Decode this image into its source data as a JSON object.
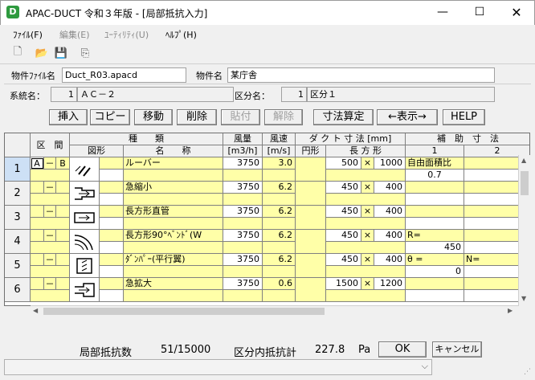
{
  "window": {
    "title": "APAC-DUCT 令和３年版 - [局部抵抗入力]",
    "icon": "D"
  },
  "menu": [
    {
      "label": "ﾌｧｲﾙ(F)",
      "enabled": true
    },
    {
      "label": "編集(E)",
      "enabled": false
    },
    {
      "label": "ﾕｰﾃｨﾘﾃｨ(U)",
      "enabled": false
    },
    {
      "label": "ﾍﾙﾌﾟ(H)",
      "enabled": true
    }
  ],
  "file": {
    "label": "物件ﾌｧｲﾙ名",
    "value": "Duct_R03.apacd",
    "name_label": "物件名",
    "name_value": "某庁舎"
  },
  "system": {
    "label": "系統名：",
    "no": "1",
    "name": "ＡＣ－２",
    "zone_label": "区分名：",
    "zone_no": "1",
    "zone_name": "区分１"
  },
  "buttons": {
    "insert": "挿入",
    "copy": "コピー",
    "move": "移動",
    "delete": "削除",
    "paste": "貼付",
    "release": "解除",
    "calc": "寸法算定",
    "display": "←表示→",
    "help": "HELP"
  },
  "headers": {
    "kukan": "区　間",
    "type": "種　　類",
    "figure": "図形",
    "name": "名　　称",
    "flow": "風量",
    "flow_unit": "[m3/h]",
    "vel": "風速",
    "vel_unit": "[m/s]",
    "duct": "ダ ク ト 寸 法 [mm]",
    "round": "円形",
    "rect": "長 方 形",
    "aux": "補　助　寸　法",
    "aux1": "1",
    "aux2": "2"
  },
  "rows": [
    {
      "no": "1",
      "k1": "A",
      "dash": "－",
      "k2": "B",
      "icon": "louver-icon",
      "name": "ルーバー",
      "flow": "3750",
      "vel": "3.0",
      "w": "500",
      "x": "×",
      "h": "1000",
      "aux1": "自由面積比",
      "aux1v": "0.7",
      "aux2": "",
      "aux2v": ""
    },
    {
      "no": "2",
      "k1": "",
      "dash": "－",
      "k2": "",
      "icon": "reducer-icon",
      "name": "急縮小",
      "flow": "3750",
      "vel": "6.2",
      "w": "450",
      "x": "×",
      "h": "400",
      "aux1": "",
      "aux1v": "",
      "aux2": "",
      "aux2v": ""
    },
    {
      "no": "3",
      "k1": "",
      "dash": "－",
      "k2": "",
      "icon": "straight-duct-icon",
      "name": "長方形直管",
      "flow": "3750",
      "vel": "6.2",
      "w": "450",
      "x": "×",
      "h": "400",
      "aux1": "",
      "aux1v": "",
      "aux2": "",
      "aux2v": ""
    },
    {
      "no": "4",
      "k1": "",
      "dash": "－",
      "k2": "",
      "icon": "bend-icon",
      "name": "長方形90°ﾍﾞﾝﾄﾞ(W",
      "flow": "3750",
      "vel": "6.2",
      "w": "450",
      "x": "×",
      "h": "400",
      "aux1": "R=",
      "aux1v": "450",
      "aux2": "",
      "aux2v": ""
    },
    {
      "no": "5",
      "k1": "",
      "dash": "－",
      "k2": "",
      "icon": "damper-icon",
      "name": "ﾀﾞﾝﾊﾟｰ(平行翼)",
      "flow": "3750",
      "vel": "6.2",
      "w": "450",
      "x": "×",
      "h": "400",
      "aux1": "θ =",
      "aux1v": "0",
      "aux2": "N=",
      "aux2v": "3"
    },
    {
      "no": "6",
      "k1": "",
      "dash": "－",
      "k2": "",
      "icon": "expander-icon",
      "name": "急拡大",
      "flow": "3750",
      "vel": "0.6",
      "w": "1500",
      "x": "×",
      "h": "1200",
      "aux1": "",
      "aux1v": "",
      "aux2": "",
      "aux2v": ""
    }
  ],
  "footer": {
    "count_label": "局部抵抗数",
    "count": "51/15000",
    "total_label": "区分内抵抗計",
    "total": "227.8",
    "unit": "Pa",
    "ok": "OK",
    "cancel": "キャンセル"
  }
}
